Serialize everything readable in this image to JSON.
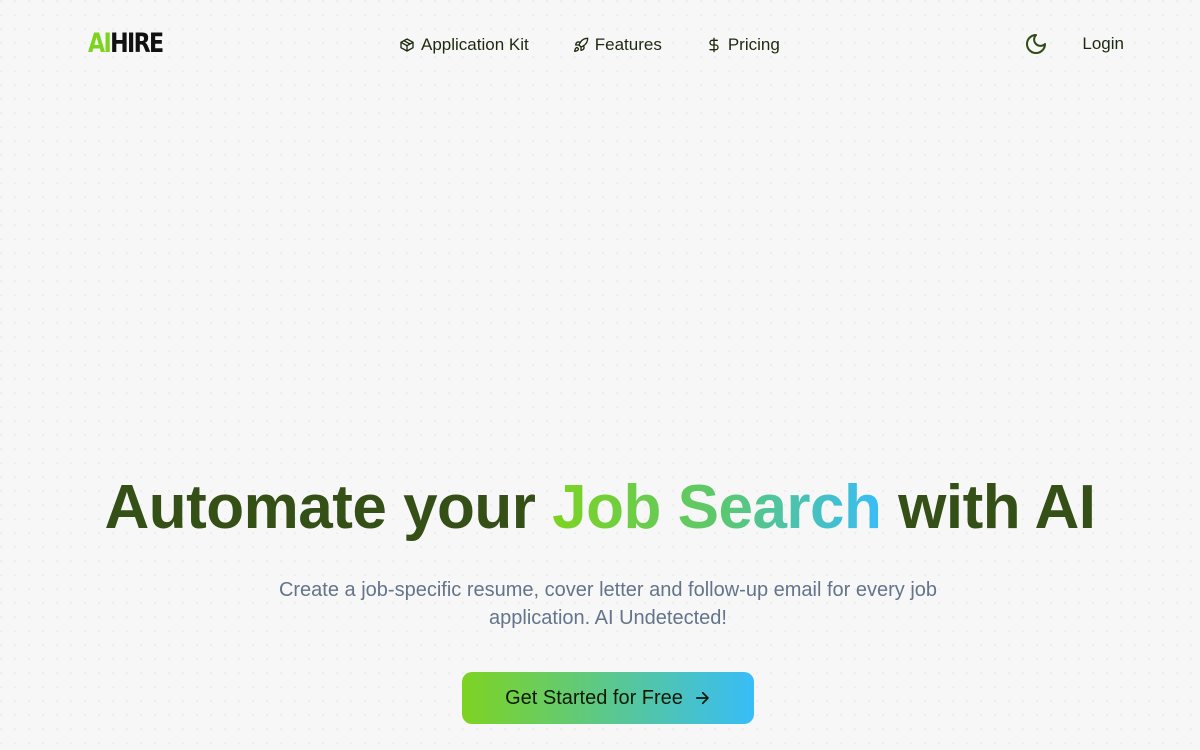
{
  "brand": {
    "logo_ai": "AI",
    "logo_hire": "HIRE",
    "accent": "#7ed321",
    "accent_end": "#38bdf8"
  },
  "nav": {
    "items": [
      {
        "label": "Application Kit",
        "icon": "package-icon"
      },
      {
        "label": "Features",
        "icon": "rocket-icon"
      },
      {
        "label": "Pricing",
        "icon": "dollar-icon"
      }
    ],
    "theme_icon": "moon-icon",
    "login_label": "Login"
  },
  "hero": {
    "title_start": "Automate your",
    "title_highlight": "Job Search",
    "title_end": "with AI",
    "subtitle": "Create a job-specific resume, cover letter and follow-up email for every job application. AI Undetected!",
    "cta_label": "Get Started for Free",
    "cta_icon": "arrow-right-icon"
  }
}
